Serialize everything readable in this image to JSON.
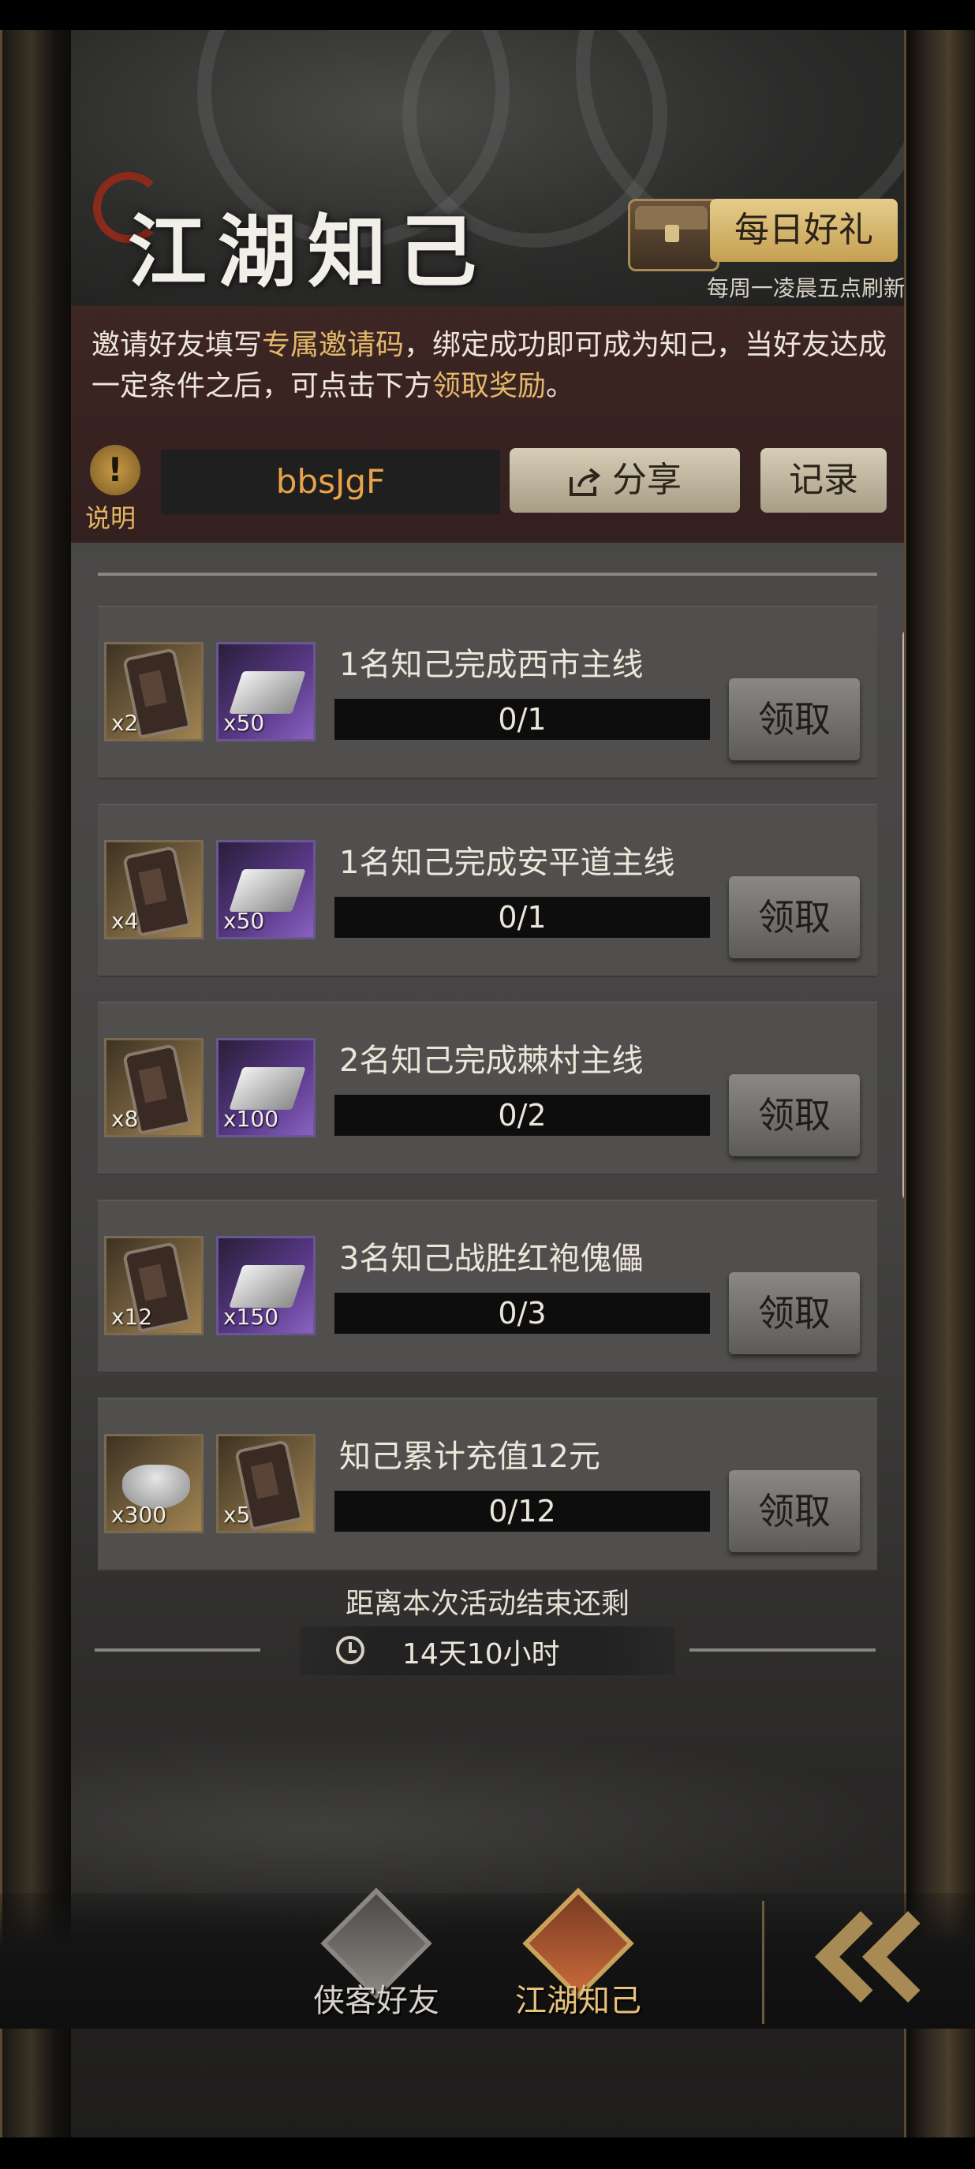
{
  "header": {
    "title": "江湖知己",
    "daily_gift_label": "每日好礼",
    "refresh_note": "每周一凌晨五点刷新"
  },
  "invite": {
    "text_parts": [
      "邀请好友填写",
      "专属邀请码",
      "，绑定成功即可成为知己，当好友达成一定条件之后，可点击下方",
      "领取奖励",
      "。"
    ],
    "info_label": "说明",
    "code": "bbsJgF",
    "share_label": "分享",
    "record_label": "记录"
  },
  "tasks": [
    {
      "title": "1名知己完成西市主线",
      "progress_text": "0/1",
      "progress": 0,
      "claim_label": "领取",
      "items": [
        {
          "icon": "token-icon",
          "count": "x2"
        },
        {
          "icon": "silver-ingot-icon",
          "count": "x50"
        }
      ]
    },
    {
      "title": "1名知己完成安平道主线",
      "progress_text": "0/1",
      "progress": 0,
      "claim_label": "领取",
      "items": [
        {
          "icon": "token-icon",
          "count": "x4"
        },
        {
          "icon": "silver-ingot-icon",
          "count": "x50"
        }
      ]
    },
    {
      "title": "2名知己完成棘村主线",
      "progress_text": "0/2",
      "progress": 0,
      "claim_label": "领取",
      "items": [
        {
          "icon": "token-icon",
          "count": "x8"
        },
        {
          "icon": "silver-ingot-icon",
          "count": "x100"
        }
      ]
    },
    {
      "title": "3名知己战胜红袍傀儡",
      "progress_text": "0/3",
      "progress": 0,
      "claim_label": "领取",
      "items": [
        {
          "icon": "token-icon",
          "count": "x12"
        },
        {
          "icon": "silver-ingot-icon",
          "count": "x150"
        }
      ]
    },
    {
      "title": "知己累计充值12元",
      "progress_text": "0/12",
      "progress": 0,
      "claim_label": "领取",
      "items": [
        {
          "icon": "yuanbao-icon",
          "count": "x300"
        },
        {
          "icon": "token-icon",
          "count": "x5"
        }
      ]
    }
  ],
  "countdown": {
    "label": "距离本次活动结束还剩",
    "remaining": "14天10小时"
  },
  "nav": {
    "tabs": [
      {
        "label": "侠客好友",
        "active": false
      },
      {
        "label": "江湖知己",
        "active": true
      }
    ]
  },
  "colors": {
    "accent_gold": "#e3b86a",
    "invite_code": "#e8a24a",
    "panel_bg": "#504f4d"
  }
}
